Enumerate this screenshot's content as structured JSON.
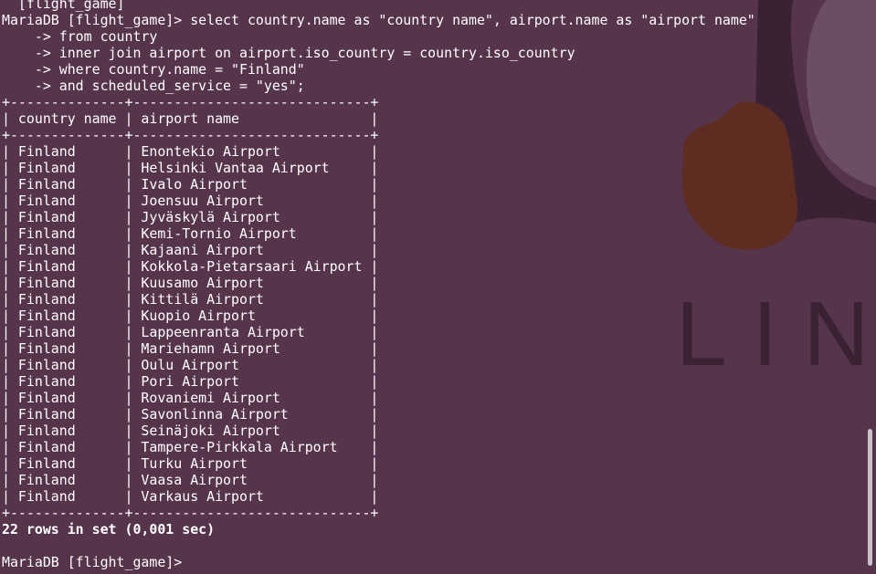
{
  "terminal": {
    "first_line_partial": "  [flight_game]",
    "query": {
      "line1": "MariaDB [flight_game]> select country.name as \"country name\", airport.name as \"airport name\"",
      "line2": "    -> from country",
      "line3": "    -> inner join airport on airport.iso_country = country.iso_country",
      "line4": "    -> where country.name = \"Finland\"",
      "line5": "    -> and scheduled_service = \"yes\";"
    },
    "table": {
      "border": "+--------------+-----------------------------+",
      "headers": [
        "country name",
        "airport name"
      ],
      "rows": [
        [
          "Finland",
          "Enontekio Airport"
        ],
        [
          "Finland",
          "Helsinki Vantaa Airport"
        ],
        [
          "Finland",
          "Ivalo Airport"
        ],
        [
          "Finland",
          "Joensuu Airport"
        ],
        [
          "Finland",
          "Jyväskylä Airport"
        ],
        [
          "Finland",
          "Kemi-Tornio Airport"
        ],
        [
          "Finland",
          "Kajaani Airport"
        ],
        [
          "Finland",
          "Kokkola-Pietarsaari Airport"
        ],
        [
          "Finland",
          "Kuusamo Airport"
        ],
        [
          "Finland",
          "Kittilä Airport"
        ],
        [
          "Finland",
          "Kuopio Airport"
        ],
        [
          "Finland",
          "Lappeenranta Airport"
        ],
        [
          "Finland",
          "Mariehamn Airport"
        ],
        [
          "Finland",
          "Oulu Airport"
        ],
        [
          "Finland",
          "Pori Airport"
        ],
        [
          "Finland",
          "Rovaniemi Airport"
        ],
        [
          "Finland",
          "Savonlinna Airport"
        ],
        [
          "Finland",
          "Seinäjoki Airport"
        ],
        [
          "Finland",
          "Tampere-Pirkkala Airport"
        ],
        [
          "Finland",
          "Turku Airport"
        ],
        [
          "Finland",
          "Vaasa Airport"
        ],
        [
          "Finland",
          "Varkaus Airport"
        ]
      ]
    },
    "result_summary": "22 rows in set (0,001 sec)",
    "prompt": "MariaDB [flight_game]> "
  },
  "wallpaper": {
    "logo_text": "LIN"
  },
  "colors": {
    "background": "#55344c",
    "text": "#ffffff",
    "logo_dark": "#3a2133",
    "logo_brown": "#5e2c20",
    "logo_gray": "#6b4e66"
  },
  "icons": {
    "cursor": "block-cursor"
  }
}
